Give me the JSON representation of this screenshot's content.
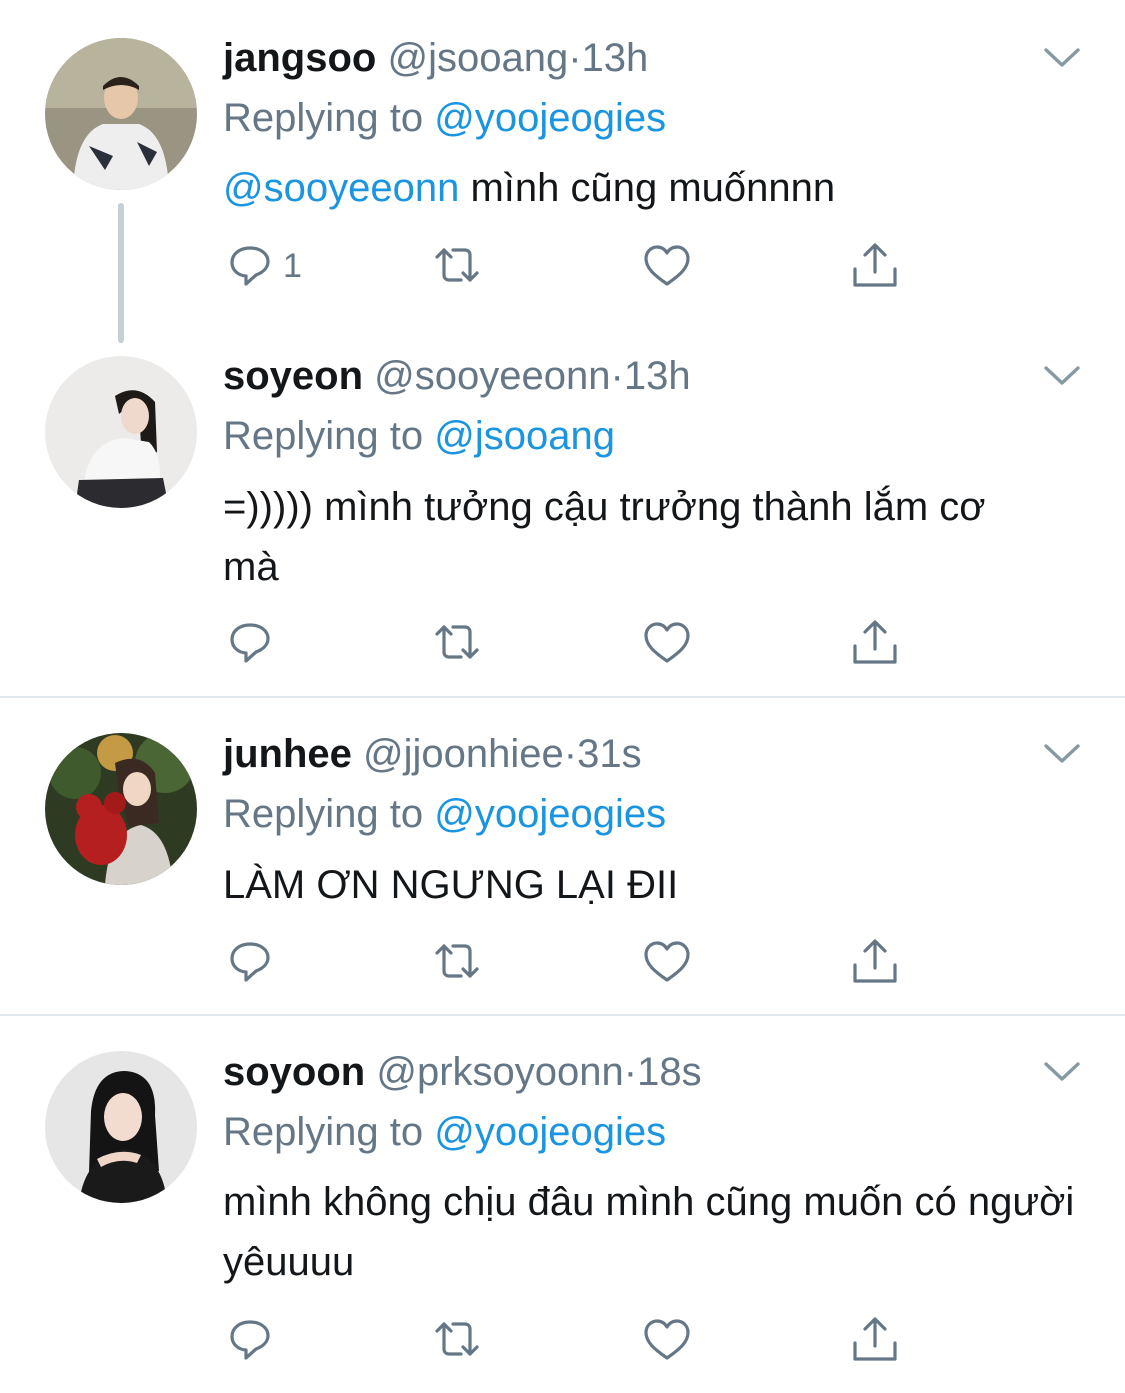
{
  "colors": {
    "link": "#1b95e0",
    "muted": "#657786",
    "text": "#14171a",
    "divider": "#e1e8ed"
  },
  "tweets": [
    {
      "name": "jangsoo",
      "handle": "@jsooang",
      "dot": "·",
      "time": "13h",
      "replying_prefix": "Replying to",
      "replying_to": "@yoojeogies",
      "mention": "@sooyeeonn",
      "text": " mình cũng muốnnnn",
      "reply_count": "1"
    },
    {
      "name": "soyeon",
      "handle": "@sooyeeonn",
      "dot": "·",
      "time": "13h",
      "replying_prefix": "Replying to",
      "replying_to": "@jsooang",
      "text": "=))))) mình tưởng cậu trưởng thành lắm cơ mà"
    },
    {
      "name": "junhee",
      "handle": "@jjoonhiee",
      "dot": "·",
      "time": "31s",
      "replying_prefix": "Replying to",
      "replying_to": "@yoojeogies",
      "text": "LÀM ƠN NGƯNG LẠI ĐII"
    },
    {
      "name": "soyoon",
      "handle": "@prksoyoonn",
      "dot": "·",
      "time": "18s",
      "replying_prefix": "Replying to",
      "replying_to": "@yoojeogies",
      "text": "mình không chịu đâu mình cũng muốn có người yêuuuu"
    }
  ],
  "icons": [
    "reply-icon",
    "retweet-icon",
    "like-icon",
    "share-icon",
    "chevron-down-icon"
  ]
}
